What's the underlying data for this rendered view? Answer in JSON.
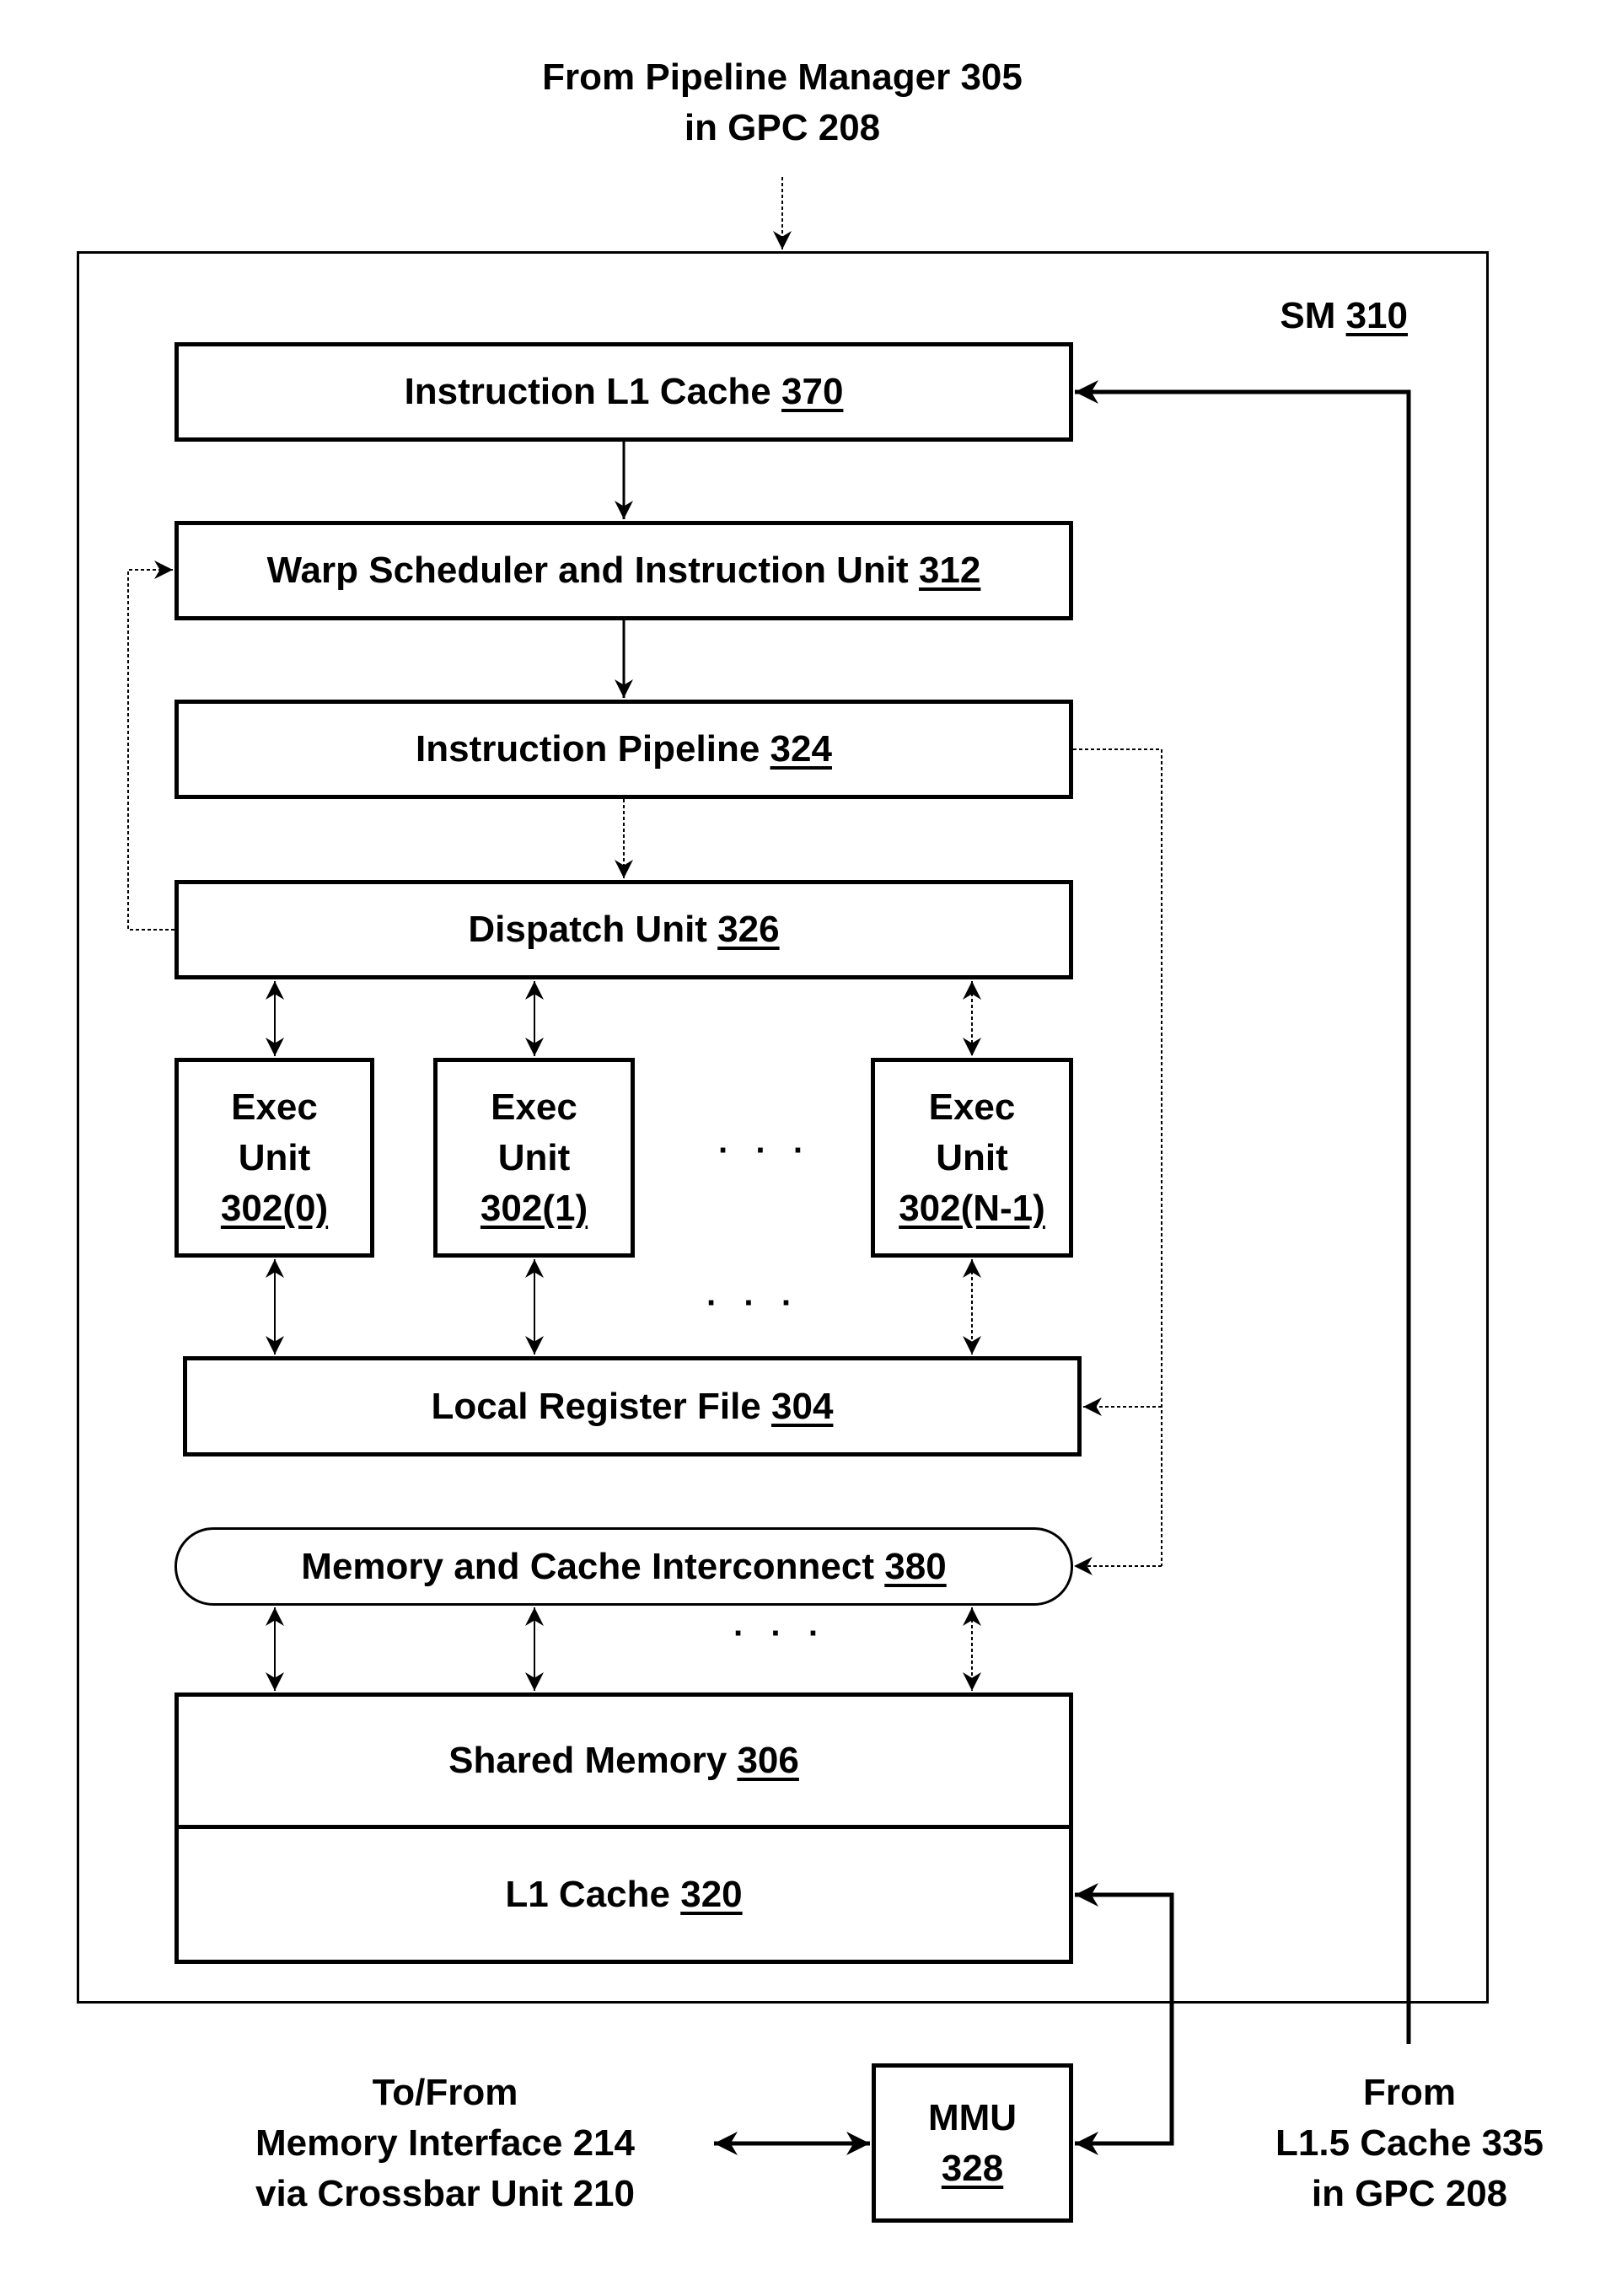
{
  "diagram": {
    "input_top": {
      "line1": "From Pipeline Manager 305",
      "line2": "in GPC 208"
    },
    "sm": {
      "label": "SM",
      "ref": "310"
    },
    "blocks": {
      "instruction_l1_cache": {
        "label": "Instruction L1 Cache",
        "ref": "370"
      },
      "warp_scheduler": {
        "label": "Warp Scheduler and Instruction Unit",
        "ref": "312"
      },
      "instruction_pipeline": {
        "label": "Instruction Pipeline",
        "ref": "324"
      },
      "dispatch_unit": {
        "label": "Dispatch Unit",
        "ref": "326"
      },
      "exec_units": [
        {
          "line1": "Exec",
          "line2": "Unit",
          "ref": "302(0)"
        },
        {
          "line1": "Exec",
          "line2": "Unit",
          "ref": "302(1)"
        },
        {
          "line1": "Exec",
          "line2": "Unit",
          "ref": "302(N-1)"
        }
      ],
      "local_register_file": {
        "label": "Local Register File",
        "ref": "304"
      },
      "memory_cache_interconnect": {
        "label": "Memory and Cache Interconnect",
        "ref": "380"
      },
      "shared_memory": {
        "label": "Shared Memory",
        "ref": "306"
      },
      "l1_cache": {
        "label": "L1 Cache",
        "ref": "320"
      },
      "mmu": {
        "label": "MMU",
        "ref": "328"
      }
    },
    "ellipsis": "· · ·",
    "external_left": {
      "line1": "To/From",
      "line2": "Memory Interface 214",
      "line3": "via Crossbar Unit 210"
    },
    "external_right": {
      "line1": "From",
      "line2": "L1.5 Cache 335",
      "line3": "in GPC 208"
    }
  }
}
